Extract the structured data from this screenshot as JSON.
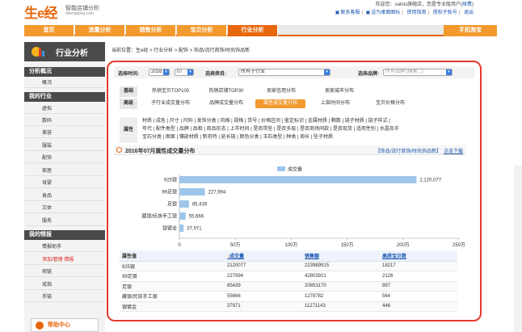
{
  "header": {
    "logo_text": "生e经",
    "logo_subtitle": "智能店铺分析",
    "logo_url": "shengejing.com",
    "welcome": "欢迎您：valois旗舰店，您是专业版用户(",
    "renew": "续费",
    "welcome_end": ")",
    "links": [
      "联系客服",
      "设为桌面图标",
      "使用指南",
      "授权子账号",
      "退出"
    ]
  },
  "nav": {
    "tabs": [
      "首页",
      "流量分析",
      "销售分析",
      "宝贝分析",
      "行业分析",
      "手机淘宝"
    ],
    "active": "行业分析"
  },
  "sidebar": {
    "title": "行业分析",
    "sections": [
      {
        "title": "分析概况",
        "items": [
          "概况"
        ]
      },
      {
        "title": "我的行业",
        "items": [
          "虚拟",
          "数码",
          "美容",
          "服装",
          "配饰",
          "家居",
          "母婴",
          "食品",
          "文体",
          "服务"
        ]
      },
      {
        "title": "我的情报",
        "items": [
          "情报助手",
          "添加/管理 情报",
          "项链",
          "戒指",
          "手链"
        ]
      }
    ],
    "help": "帮助中心"
  },
  "breadcrumb": "当前位置：生e经 > 行业分析 > 配饰 > 饰品/流行首饰/时尚饰品新",
  "filters": {
    "time_label": "选择时间:",
    "year": "2016",
    "month": "07",
    "category_label": "选择类目:",
    "category_value": "所有子行业",
    "brand_label": "选择品牌:",
    "brand_placeholder": "所有品牌 (搜索...)"
  },
  "tabs_basic": {
    "label": "基础",
    "items": [
      "热销宝贝TOP100",
      "热销店铺TOP30",
      "卖家信用分布",
      "卖家城市分布"
    ]
  },
  "tabs_advanced": {
    "label": "高级",
    "items": [
      "子行业成交量分布",
      "品牌成交量分布",
      "属性成交量分布",
      "上架时间分布",
      "宝贝价格分布"
    ],
    "active": "属性成交量分布"
  },
  "attributes": {
    "label": "属性",
    "lines": [
      "材质 | 成色 | 尺寸 | 尺码 | 发饰分类 | 风格 | 规格 | 货号 | 价格区间 | 鉴定标识 | 金属材质 | 颗数 | 链子材质 | 链子样式 |",
      "年代 | 配件类型 | 品牌 | 品相 | 商品形态 | 上市时间 | 是否带坠 | 是否多层 | 是否商场同款 | 是否现货 | 适用性别 | 水晶及半",
      "宝石分类 | 图案 | 镶嵌材质 | 新奇特 | 延长链 | 颜色分类 | 玉石类型 | 种类 | 周长 | 坠子材质"
    ]
  },
  "section": {
    "title": "2016年07月属性成交量分布",
    "category": "【饰品/流行首饰/时尚饰品新】",
    "download": "点击下载"
  },
  "chart_data": {
    "type": "bar",
    "orientation": "horizontal",
    "legend": "成交量",
    "categories": [
      "925银",
      "99足银",
      "足银",
      "藏银/民族手工银",
      "银镀金"
    ],
    "values": [
      2120077,
      227994,
      85439,
      55666,
      37971
    ],
    "value_labels": [
      "2,120,077",
      "227,994",
      "85,439",
      "55,666",
      "37,971"
    ],
    "xlim": [
      0,
      2500000
    ],
    "ticks": [
      0,
      500000,
      1000000,
      1500000,
      2000000,
      2500000
    ],
    "tick_labels": [
      "0",
      "50万",
      "100万",
      "150万",
      "200万",
      "250万"
    ],
    "bar_color": "#9ec5ea"
  },
  "table": {
    "headers": [
      "属性值",
      "成交量",
      "销售额",
      "高质宝贝数"
    ],
    "rows": [
      [
        "925银",
        "2120077",
        "223989915",
        "18217"
      ],
      [
        "99足银",
        "227994",
        "42803921",
        "2126"
      ],
      [
        "足银",
        "85439",
        "20853170",
        "997"
      ],
      [
        "藏银/民族手工银",
        "55666",
        "1278782",
        "564"
      ],
      [
        "银镀金",
        "37971",
        "11271143",
        "446"
      ]
    ]
  },
  "colors": {
    "accent": "#e8660c",
    "tab": "#f29a2e",
    "frame": "#e53a2a",
    "link": "#1a56b0"
  }
}
